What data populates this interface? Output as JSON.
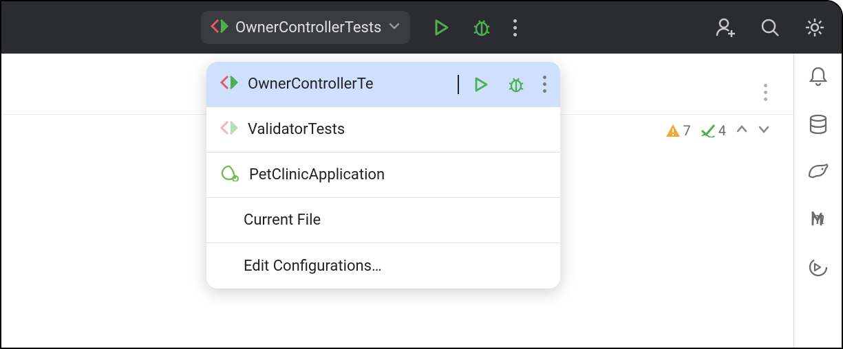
{
  "toolbar": {
    "run_config": "OwnerControllerTests"
  },
  "dropdown": {
    "items": [
      {
        "label": "OwnerControllerTe",
        "type": "test",
        "selected": true,
        "has_actions": true
      },
      {
        "label": "ValidatorTests",
        "type": "test-muted",
        "selected": false,
        "has_actions": false
      },
      {
        "label": "PetClinicApplication",
        "type": "spring",
        "selected": false,
        "has_actions": false
      },
      {
        "label": "Current File",
        "type": "none",
        "selected": false,
        "has_actions": false
      },
      {
        "label": "Edit Configurations…",
        "type": "none",
        "selected": false,
        "has_actions": false
      }
    ]
  },
  "editor": {
    "warnings": "7",
    "checks": "4"
  }
}
